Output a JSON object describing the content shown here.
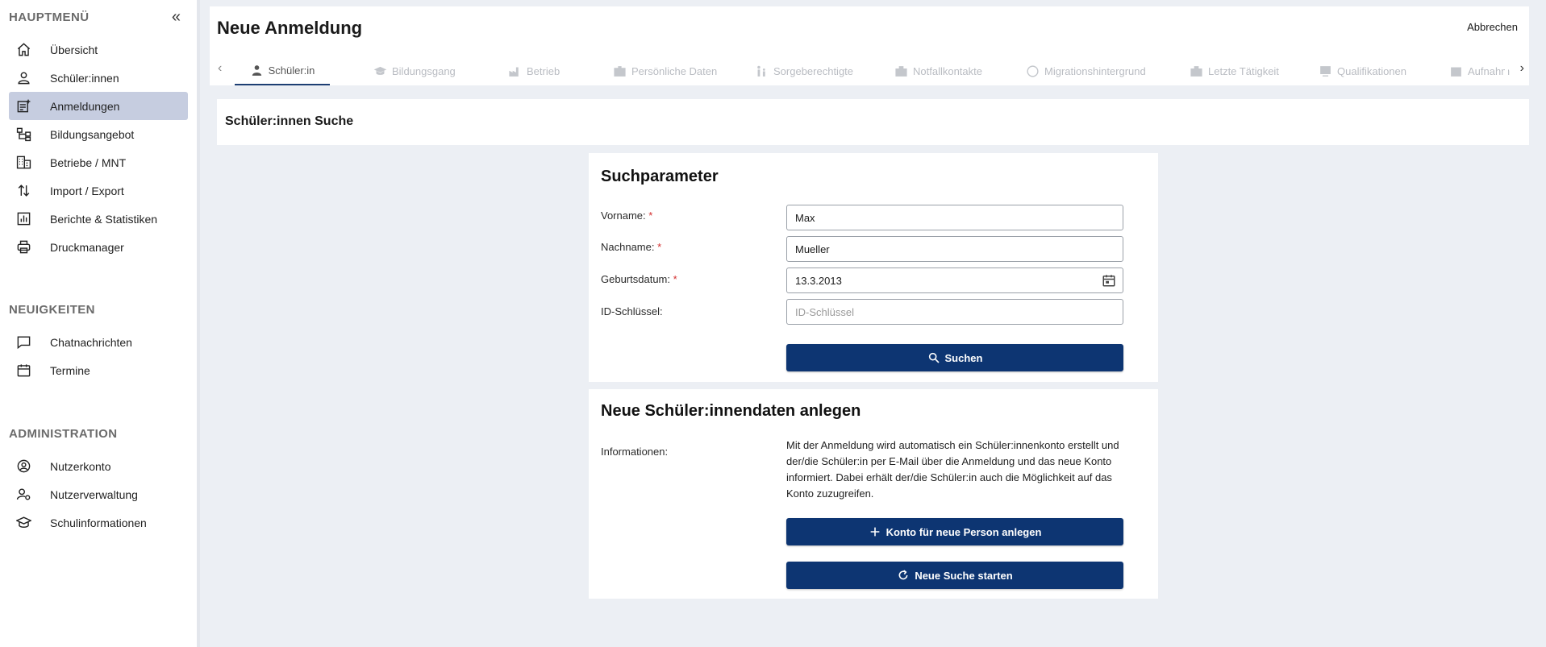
{
  "sidebar": {
    "main_title": "HAUPTMENÜ",
    "main_items": [
      {
        "label": "Übersicht",
        "icon": "home-icon"
      },
      {
        "label": "Schüler:innen",
        "icon": "user-icon"
      },
      {
        "label": "Anmeldungen",
        "icon": "registration-icon",
        "active": true
      },
      {
        "label": "Bildungsangebot",
        "icon": "hierarchy-icon"
      },
      {
        "label": "Betriebe / MNT",
        "icon": "building-icon"
      },
      {
        "label": "Import / Export",
        "icon": "import-export-icon"
      },
      {
        "label": "Berichte & Statistiken",
        "icon": "chart-icon"
      },
      {
        "label": "Druckmanager",
        "icon": "printer-icon"
      }
    ],
    "news_title": "NEUIGKEITEN",
    "news_items": [
      {
        "label": "Chatnachrichten",
        "icon": "chat-icon"
      },
      {
        "label": "Termine",
        "icon": "calendar-icon"
      }
    ],
    "admin_title": "ADMINISTRATION",
    "admin_items": [
      {
        "label": "Nutzerkonto",
        "icon": "account-icon"
      },
      {
        "label": "Nutzerverwaltung",
        "icon": "user-settings-icon"
      },
      {
        "label": "Schulinformationen",
        "icon": "school-icon"
      }
    ]
  },
  "header": {
    "title": "Neue Anmeldung",
    "cancel_label": "Abbrechen"
  },
  "tabs": [
    {
      "label": "Schüler:in",
      "active": true
    },
    {
      "label": "Bildungsgang"
    },
    {
      "label": "Betrieb"
    },
    {
      "label": "Persönliche Daten"
    },
    {
      "label": "Sorgeberechtigte"
    },
    {
      "label": "Notfallkontakte"
    },
    {
      "label": "Migrationshintergrund"
    },
    {
      "label": "Letzte Tätigkeit"
    },
    {
      "label": "Qualifikationen"
    },
    {
      "label": "Aufnahm"
    }
  ],
  "search_section": {
    "title": "Schüler:innen Suche"
  },
  "search_params": {
    "title": "Suchparameter",
    "required_marker": "*",
    "first_name_label": "Vorname:",
    "first_name_value": "Max",
    "last_name_label": "Nachname:",
    "last_name_value": "Mueller",
    "birthdate_label": "Geburtsdatum:",
    "birthdate_value": "13.3.2013",
    "id_label": "ID-Schlüssel:",
    "id_placeholder": "ID-Schlüssel",
    "search_button": "Suchen"
  },
  "new_student": {
    "title": "Neue Schüler:innendaten anlegen",
    "info_label": "Informationen:",
    "info_text": "Mit der Anmeldung wird automatisch ein Schüler:innenkonto erstellt und der/die Schüler:in per E-Mail über die Anmeldung und das neue Konto informiert. Dabei erhält der/die Schüler:in auch die Möglichkeit auf das Konto zuzugreifen.",
    "create_button": "Konto für neue Person anlegen",
    "restart_button": "Neue Suche starten"
  },
  "colors": {
    "primary": "#0d3572",
    "active_nav": "#c6cde0",
    "background": "#eceff4",
    "required": "#d32f2f"
  }
}
